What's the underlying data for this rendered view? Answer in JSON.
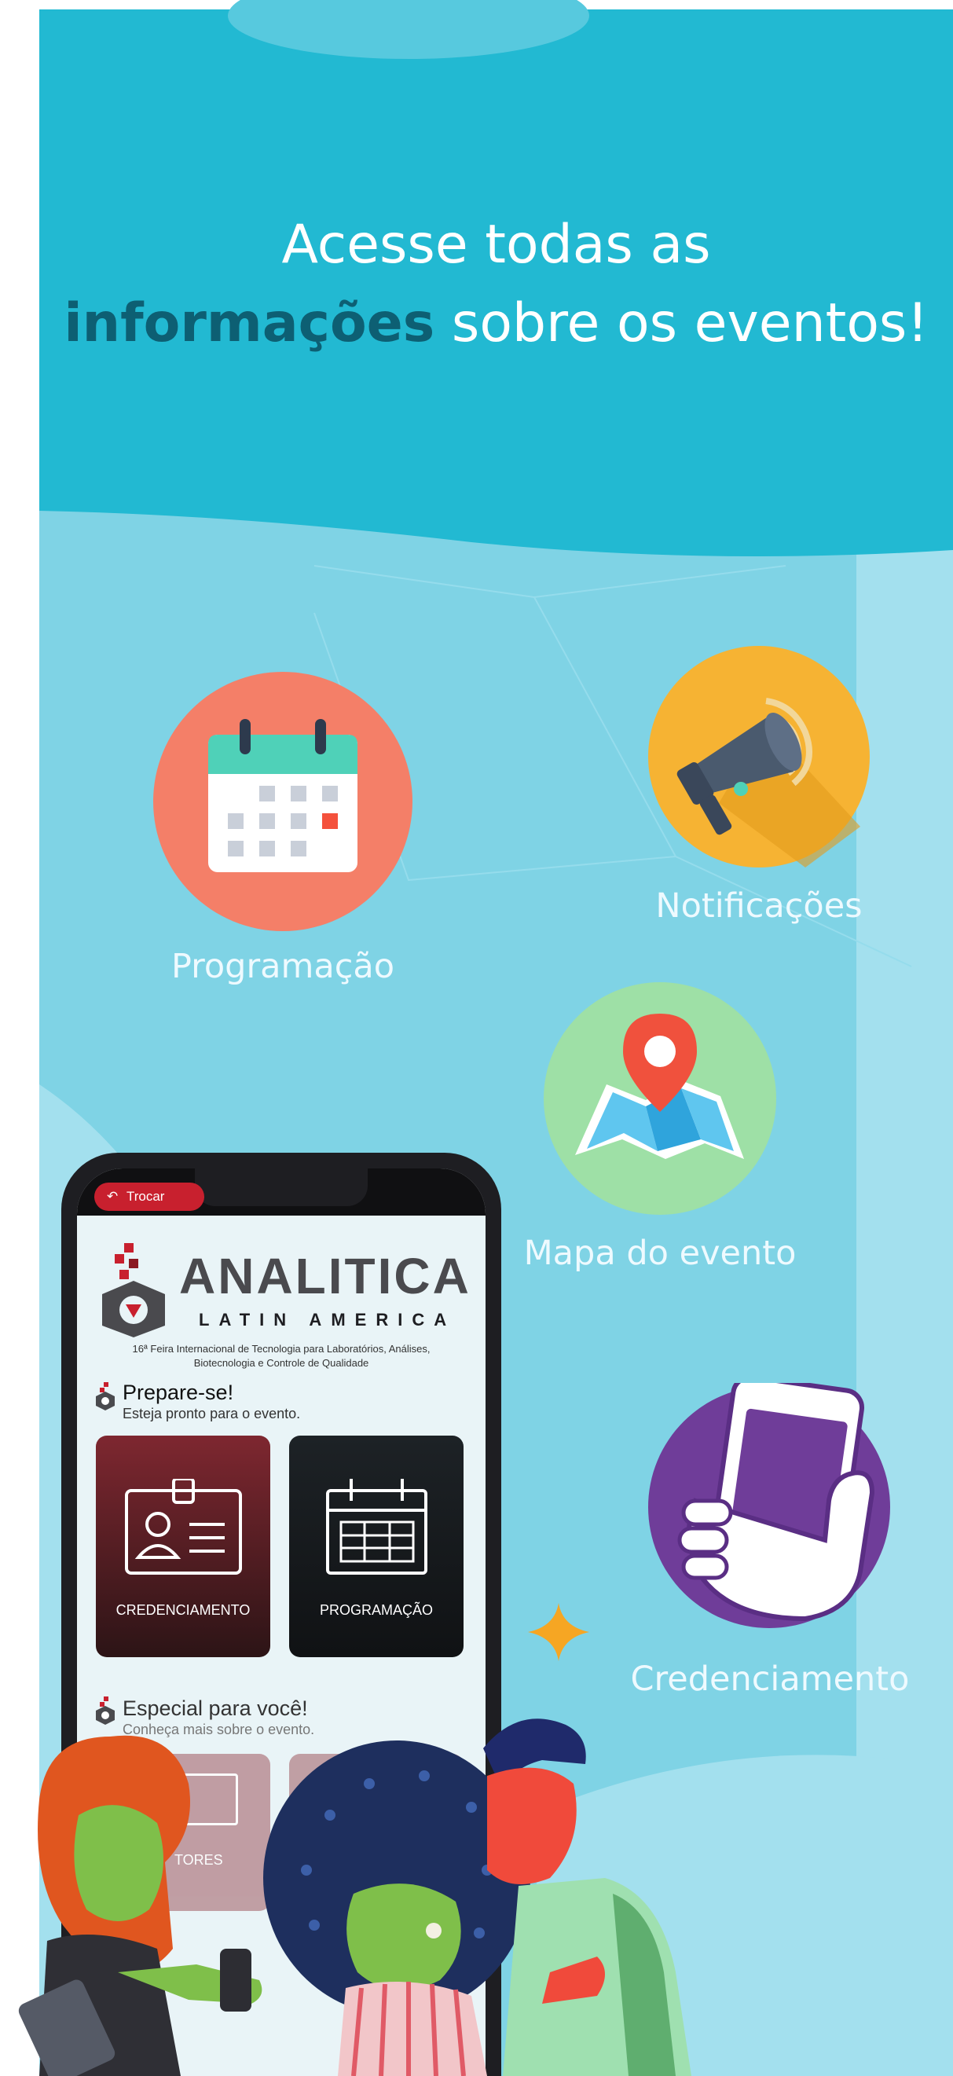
{
  "headline": {
    "line1": "Acesse todas as",
    "highlight": "informações",
    "line2_rest": " sobre os eventos!"
  },
  "features": [
    {
      "label": "Programação",
      "icon": "calendar-icon",
      "color": "#f47f68"
    },
    {
      "label": "Notificações",
      "icon": "megaphone-icon",
      "color": "#f6b333"
    },
    {
      "label": "Mapa do evento",
      "icon": "map-pin-icon",
      "color": "#9ee0a6"
    },
    {
      "label": "Credenciamento",
      "icon": "phone-hand-icon",
      "color": "#6f3d99"
    }
  ],
  "phone": {
    "back_label": "Trocar",
    "brand": "ANALITICA",
    "brand_sub": "LATIN AMERICA",
    "tagline_1": "16ª Feira Internacional de Tecnologia para Laboratórios, Análises,",
    "tagline_2": "Biotecnologia e Controle de Qualidade",
    "section1_title": "Prepare-se!",
    "section1_sub": "Esteja pronto para o evento.",
    "card1_label": "CREDENCIAMENTO",
    "card2_label": "PROGRAMAÇÃO",
    "section2_title": "Especial para você!",
    "section2_sub": "Conheça mais sobre o evento.",
    "card3_label": "TORES"
  },
  "colors": {
    "top_band": "#22b9d2",
    "body_bg": "#7fd3e5",
    "headline_highlight": "#0d5f73",
    "sparkle": "#f6a623",
    "phone_accent": "#c8202e"
  }
}
